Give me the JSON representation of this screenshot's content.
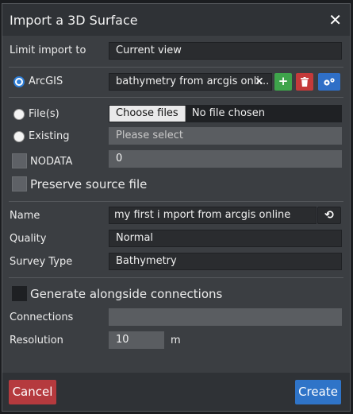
{
  "dialog": {
    "title": "Import a 3D Surface"
  },
  "limit_import": {
    "label": "Limit import to",
    "value": "Current view"
  },
  "source": {
    "arcgis": {
      "label": "ArcGIS",
      "value": "bathymetry from arcgis onli...",
      "selected": true
    },
    "files": {
      "label": "File(s)",
      "button": "Choose files",
      "status": "No file chosen"
    },
    "existing": {
      "label": "Existing",
      "placeholder": "Please select"
    },
    "nodata": {
      "label": "NODATA",
      "value": "0"
    }
  },
  "preserve_source": {
    "label": "Preserve source file"
  },
  "name": {
    "label": "Name",
    "value": "my first i mport from arcgis online"
  },
  "quality": {
    "label": "Quality",
    "value": "Normal"
  },
  "survey_type": {
    "label": "Survey Type",
    "value": "Bathymetry"
  },
  "generate_connections": {
    "label": "Generate alongside connections"
  },
  "connections": {
    "label": "Connections",
    "value": ""
  },
  "resolution": {
    "label": "Resolution",
    "value": "10",
    "unit": "m"
  },
  "footer": {
    "cancel": "Cancel",
    "create": "Create"
  },
  "colors": {
    "accent": "#2f7fd8",
    "add": "#3ea44b",
    "delete": "#c43a3a",
    "settings": "#2f6fc7",
    "cancel": "#b53a3e",
    "create": "#2f74c8"
  }
}
